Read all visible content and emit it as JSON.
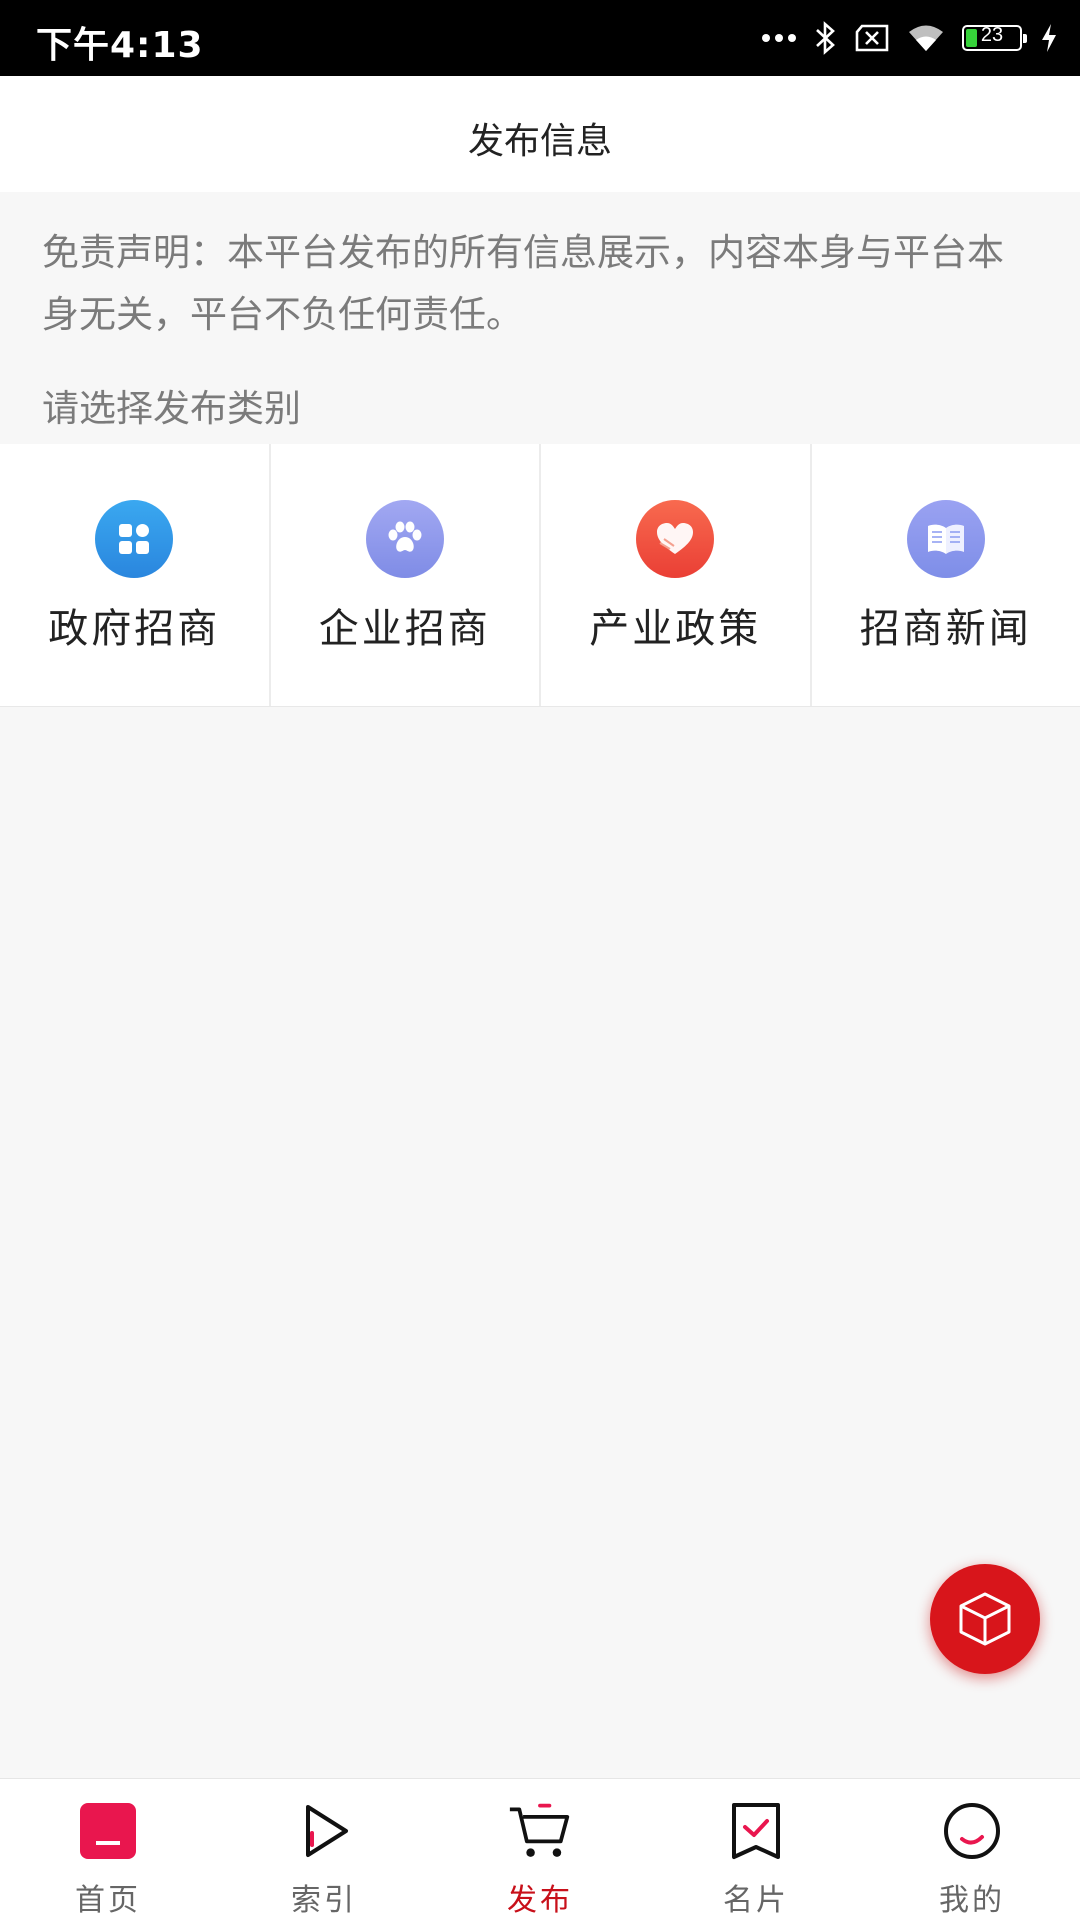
{
  "status_bar": {
    "time": "下午4:13",
    "battery": "23"
  },
  "header": {
    "title": "发布信息"
  },
  "disclaimer": "免责声明：本平台发布的所有信息展示，内容本身与平台本身无关，平台不负任何责任。",
  "category_prompt": "请选择发布类别",
  "categories": [
    {
      "label": "政府招商",
      "icon": "apps-grid-icon",
      "color": "#2b8fe0"
    },
    {
      "label": "企业招商",
      "icon": "paw-icon",
      "color": "#8c96ea"
    },
    {
      "label": "产业政策",
      "icon": "heart-hands-icon",
      "color": "#f0513f"
    },
    {
      "label": "招商新闻",
      "icon": "book-icon",
      "color": "#8a9af0"
    }
  ],
  "tabbar": {
    "items": [
      {
        "label": "首页",
        "icon": "home-icon"
      },
      {
        "label": "索引",
        "icon": "play-icon"
      },
      {
        "label": "发布",
        "icon": "cart-icon",
        "active": true
      },
      {
        "label": "名片",
        "icon": "bookmark-check-icon"
      },
      {
        "label": "我的",
        "icon": "profile-circle-icon"
      }
    ],
    "active_color": "#c8101a"
  },
  "fab": {
    "icon": "cube-icon",
    "color": "#d8151b"
  }
}
